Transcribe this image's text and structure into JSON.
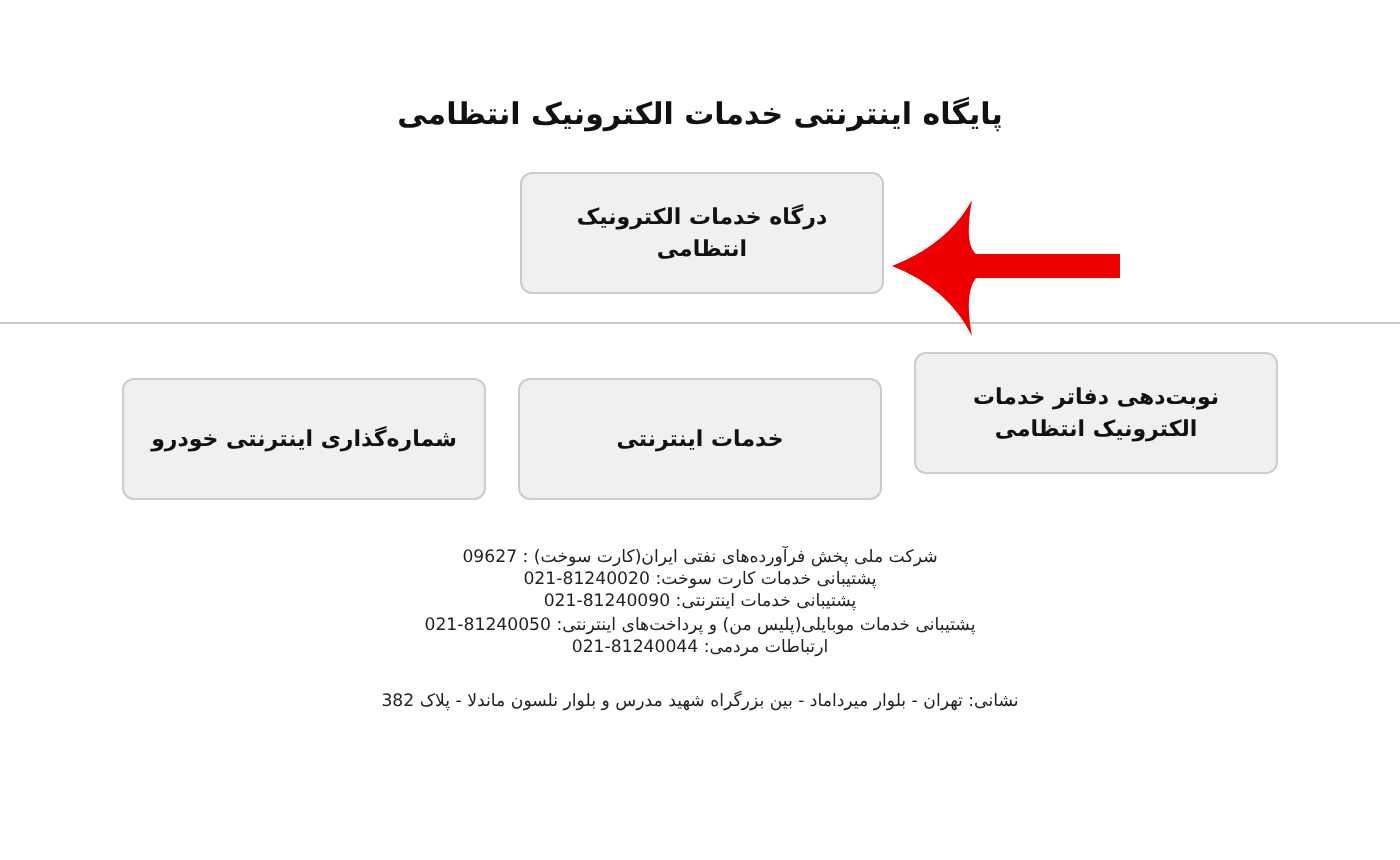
{
  "title": "پایگاه اینترنتی خدمات الکترونیک انتظامی",
  "main_button": {
    "label": "درگاه خدمات الکترونیک انتظامی",
    "annotated": true
  },
  "service_buttons": [
    {
      "label": "نوبت‌دهی دفاتر خدمات الکترونیک انتظامی"
    },
    {
      "label": "خدمات اینترنتی"
    },
    {
      "label": "شماره‌گذاری اینترنتی خودرو"
    }
  ],
  "contact_lines": [
    "شرکت ملی پخش فرآورده‌های نفتی ایران(کارت سوخت) : 09627",
    "پشتیبانی خدمات کارت سوخت: 021-81240020",
    "پشتیبانی خدمات اینترنتی: 021-81240090",
    "پشتیبانی خدمات موبایلی(پلیس من) و پرداخت‌های اینترنتی: 021-81240050",
    "ارتباطات مردمی: 021-81240044"
  ],
  "address": "نشانی: تهران - بلوار میرداماد - بین بزرگراه شهید مدرس و بلوار نلسون ماندلا - پلاک 382"
}
